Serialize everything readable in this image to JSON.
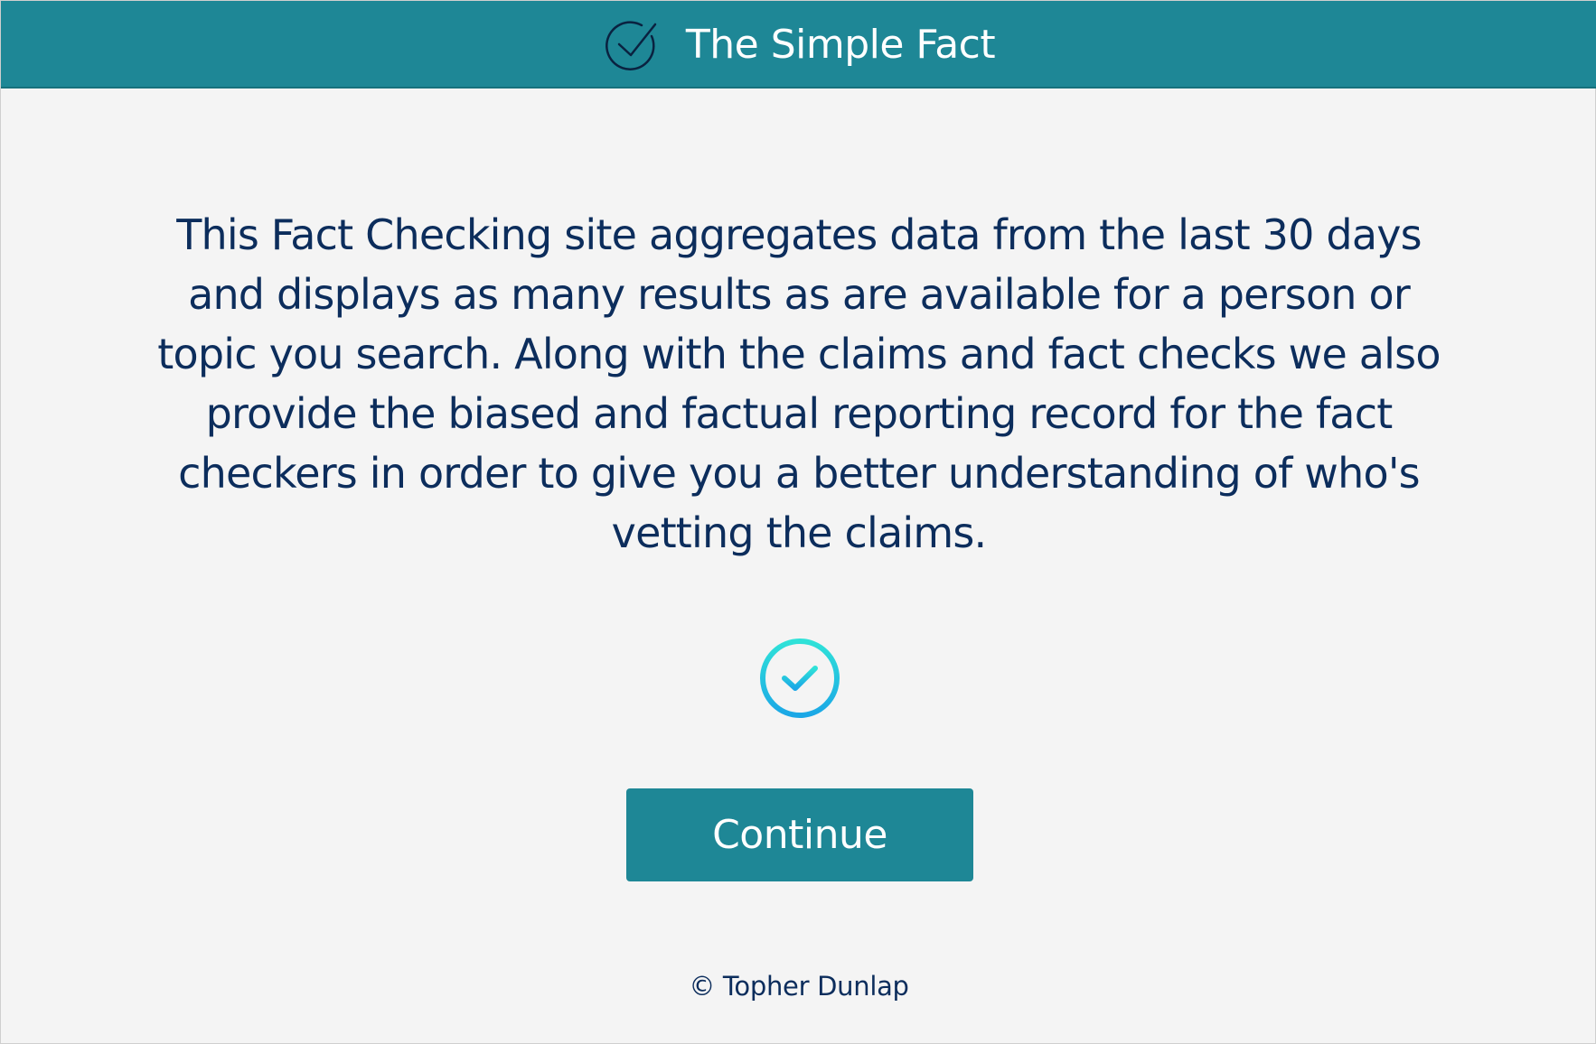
{
  "header": {
    "logo_icon": "circle-check-icon",
    "title": "The Simple Fact",
    "background_color": "#1e8796"
  },
  "main": {
    "intro_text": "This Fact Checking site aggregates data from the last 30 days and displays as many results as are available for a person or topic you search. Along with the claims and fact checks we also provide the biased and factual reporting record for the fact checkers in order to give you a better understanding of who's vetting the claims.",
    "status_icon": "gradient-check-circle-icon",
    "continue_label": "Continue",
    "text_color": "#0c2d5c",
    "accent_gradient": [
      "#2fe2d8",
      "#1ba7e6"
    ]
  },
  "footer": {
    "copyright": "© Topher Dunlap"
  }
}
